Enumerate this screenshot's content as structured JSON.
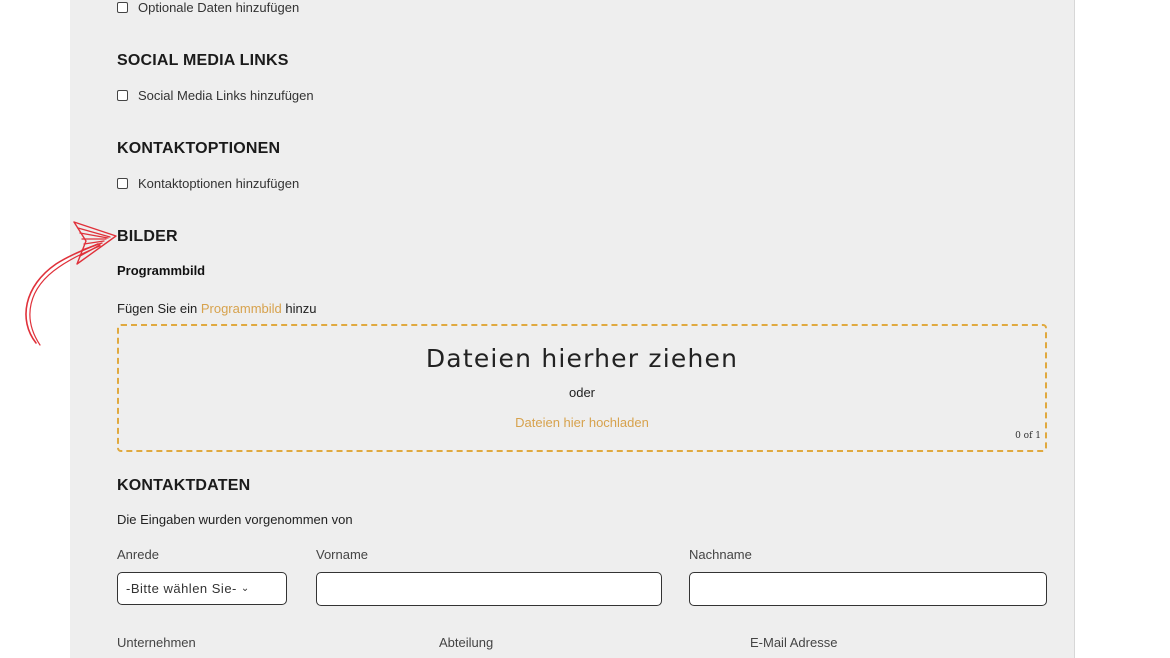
{
  "optional": {
    "checkbox_label": "Optionale Daten hinzufügen"
  },
  "social": {
    "heading": "SOCIAL MEDIA LINKS",
    "checkbox_label": "Social Media Links hinzufügen"
  },
  "contact_options": {
    "heading": "KONTAKTOPTIONEN",
    "checkbox_label": "Kontaktoptionen hinzufügen"
  },
  "images": {
    "heading": "BILDER",
    "subheading": "Programmbild",
    "instruction_prefix": "Fügen Sie ein ",
    "instruction_link": "Programmbild",
    "instruction_suffix": " hinzu",
    "dropzone": {
      "title": "Dateien hierher ziehen",
      "or": "oder",
      "upload_link": "Dateien hier hochladen",
      "count": "0 of 1"
    }
  },
  "contact_data": {
    "heading": "KONTAKTDATEN",
    "intro": "Die Eingaben wurden vorgenommen von",
    "salutation_label": "Anrede",
    "salutation_value": "-Bitte wählen Sie-",
    "firstname_label": "Vorname",
    "lastname_label": "Nachname",
    "company_label": "Unternehmen",
    "department_label": "Abteilung",
    "email_label": "E-Mail Adresse"
  },
  "annotation": {
    "arrow_color": "#e0313a"
  }
}
